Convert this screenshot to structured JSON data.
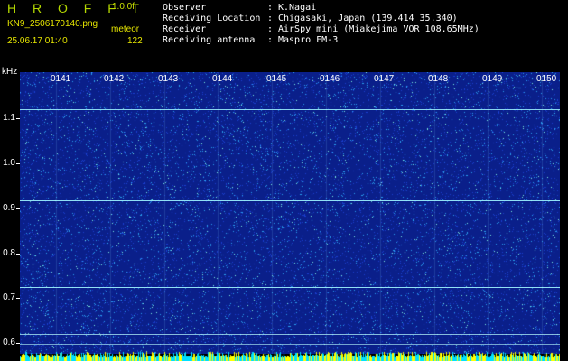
{
  "header": {
    "brand": "H R O F F T",
    "version": "1.0.0f",
    "filename": "KN9_2506170140.png",
    "mode": "meteor",
    "datetime": "25.06.17 01:40",
    "count": "122"
  },
  "meta": {
    "observer_label": "Observer",
    "observer_value": "K.Nagai",
    "location_label": "Receiving Location",
    "location_value": "Chigasaki, Japan (139.414 35.340)",
    "receiver_label": "Receiver",
    "receiver_value": "AirSpy mini (Miakejima VOR 108.65MHz)",
    "antenna_label": "Receiving antenna",
    "antenna_value": "Maspro FM-3",
    "separator": ":"
  },
  "waterfall": {
    "y_unit": "kHz",
    "y_labels": [
      "1.1",
      "1.0",
      "0.9",
      "0.8",
      "0.7",
      "0.6"
    ],
    "time_labels": [
      "0141",
      "0142",
      "0143",
      "0144",
      "0145",
      "0146",
      "0147",
      "0148",
      "0149",
      "0150"
    ],
    "colors": {
      "background": "#0a1f8a",
      "noise_low": "#1a3fd0",
      "noise_mid": "#2a9ff0",
      "noise_high": "#7ff0e0",
      "carrier": "#9ef5ff",
      "bottom_bar_a": "#ffff00",
      "bottom_bar_b": "#00e0ff"
    }
  }
}
